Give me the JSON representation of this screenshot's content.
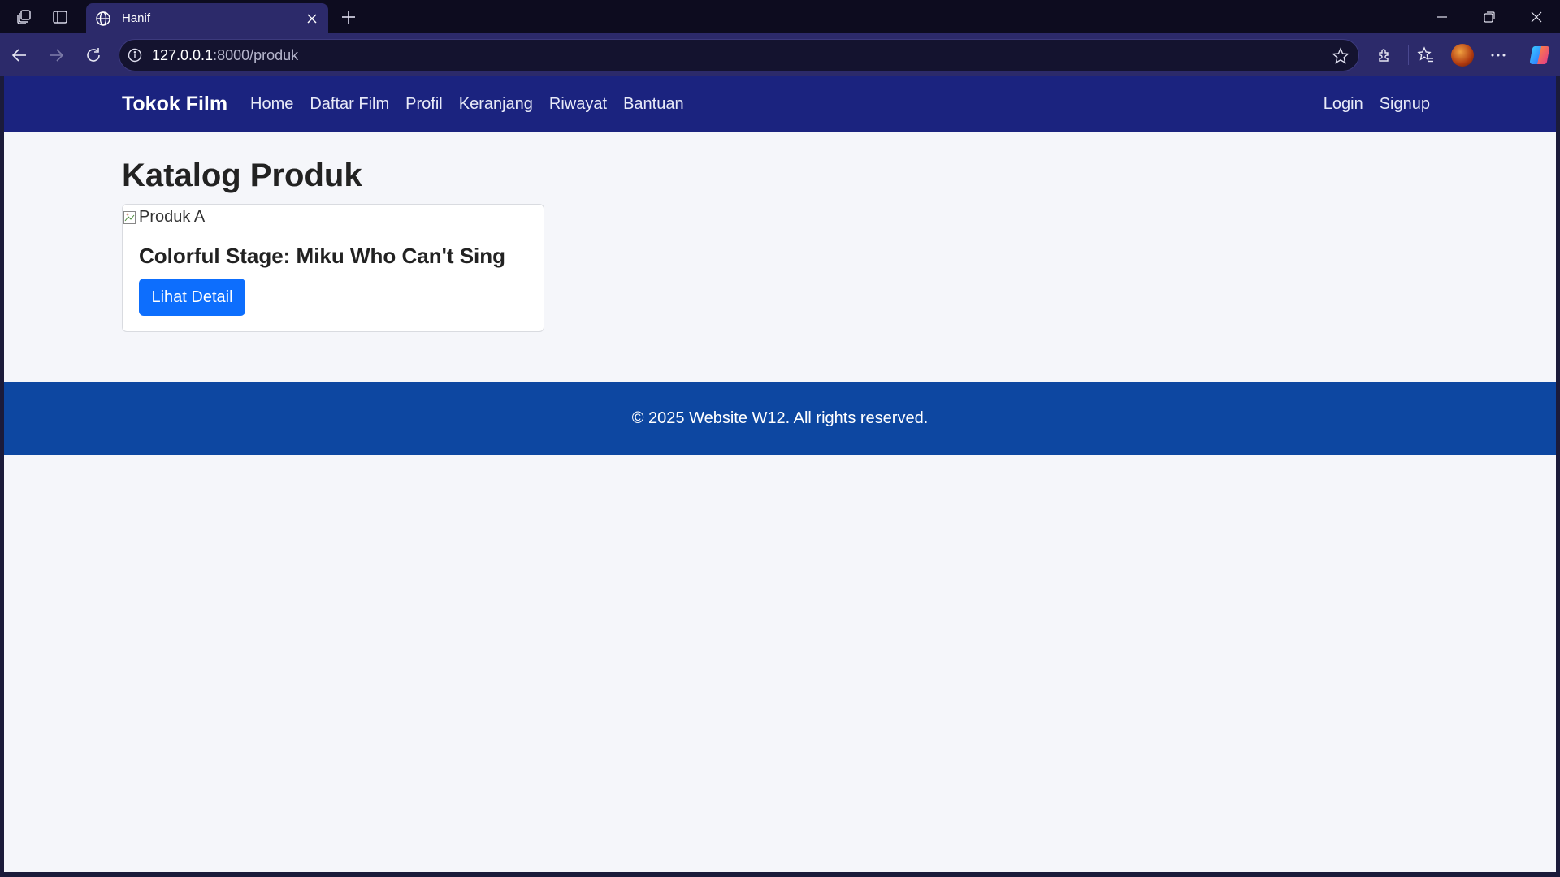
{
  "browser": {
    "tab_title": "Hanif",
    "address_host": "127.0.0.1",
    "address_path": ":8000/produk"
  },
  "site": {
    "brand": "Tokok Film",
    "nav_links": [
      "Home",
      "Daftar Film",
      "Profil",
      "Keranjang",
      "Riwayat",
      "Bantuan"
    ],
    "auth_links": [
      "Login",
      "Signup"
    ],
    "nav_color": "#1b237f"
  },
  "main": {
    "title": "Katalog Produk",
    "products": [
      {
        "image_alt": "Produk A",
        "name": "Colorful Stage: Miku Who Can't Sing",
        "button_label": "Lihat Detail"
      }
    ]
  },
  "footer": {
    "text": "© 2025 Website W12. All rights reserved.",
    "color": "#0d47a1"
  }
}
